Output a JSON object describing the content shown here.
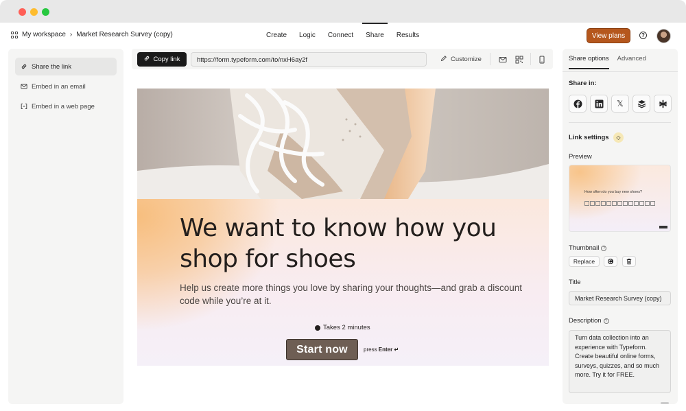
{
  "topnav": {
    "workspace": "My workspace",
    "form_name": "Market Research Survey (copy)",
    "tabs": [
      {
        "label": "Create"
      },
      {
        "label": "Logic"
      },
      {
        "label": "Connect"
      },
      {
        "label": "Share"
      },
      {
        "label": "Results"
      }
    ],
    "active_tab": "Share",
    "view_plans": "View plans",
    "accent": "#b5571d"
  },
  "sidebar": {
    "items": [
      {
        "label": "Share the link",
        "icon": "link-icon"
      },
      {
        "label": "Embed in an email",
        "icon": "mail-icon"
      },
      {
        "label": "Embed in a web page",
        "icon": "code-icon"
      }
    ]
  },
  "toolbar": {
    "copy_link": "Copy link",
    "url": "https://form.typeform.com/to/nxH6ay2f",
    "customize": "Customize"
  },
  "form": {
    "title": "We want to know how you shop for shoes",
    "description": "Help us create more things you love by sharing your thoughts—and grab a discount code while you’re at it.",
    "takes": "Takes 2 minutes",
    "start": "Start now",
    "press": "press",
    "enter": "Enter ↵",
    "button_color": "#6e5e54"
  },
  "right": {
    "tabs": [
      {
        "label": "Share options"
      },
      {
        "label": "Advanced"
      }
    ],
    "share_in": "Share in:",
    "link_settings": "Link settings",
    "preview": "Preview",
    "preview_question": "How often do you buy new shoes?",
    "thumbnail": "Thumbnail",
    "replace": "Replace",
    "title_label": "Title",
    "title_value": "Market Research Survey (copy)",
    "description_label": "Description",
    "description_value": "Turn data collection into an experience with Typeform. Create beautiful online forms, surveys, quizzes, and so much more. Try it for FREE."
  }
}
